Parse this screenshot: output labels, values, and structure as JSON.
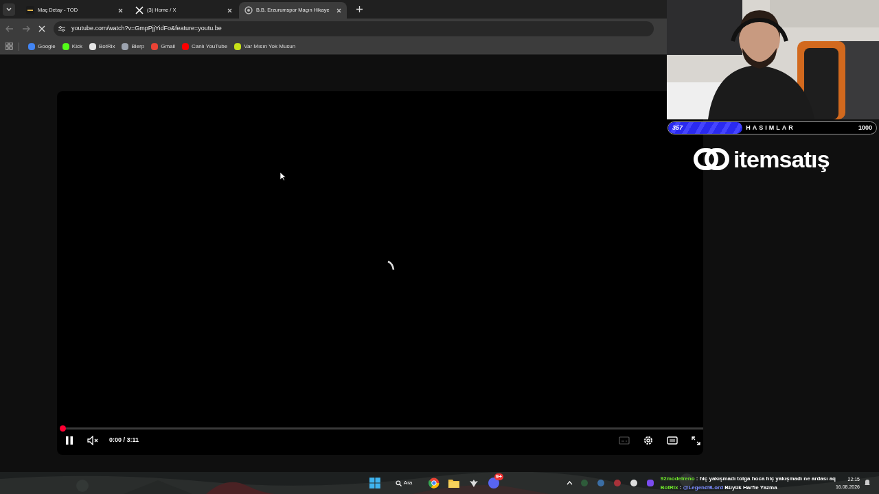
{
  "tabs": [
    {
      "title": "Maç Detay - TOD",
      "selected": false
    },
    {
      "title": "(3) Home / X",
      "selected": false
    },
    {
      "title": "B.B. Erzurumspor Maçın Hikaye",
      "selected": true
    }
  ],
  "address_bar": {
    "url": "youtube.com/watch?v=GmpPjjYidFo&feature=youtu.be",
    "loading": true
  },
  "bookmarks": [
    {
      "label": "Google",
      "color": "#4285f4"
    },
    {
      "label": "Kick",
      "color": "#53fc18"
    },
    {
      "label": "BotRix",
      "color": "#e5e5e5"
    },
    {
      "label": "Blerp",
      "color": "#9ca3af"
    },
    {
      "label": "Gmail",
      "color": "#ea4335"
    },
    {
      "label": "Canlı YouTube",
      "color": "#ff0000"
    },
    {
      "label": "Var Mısın Yok Musun",
      "color": "#c6e018"
    }
  ],
  "player": {
    "level": 0,
    "time": "0:00 / 3:11",
    "playing": true,
    "muted": true,
    "buffering": true
  },
  "overlay": {
    "goal_current": "357",
    "goal_label": "HASIMLAR",
    "goal_target": "1000",
    "level": 0.357,
    "sponsor": "itemsatış"
  },
  "taskbar": {
    "search": "Ara",
    "discord_badge": "9+"
  },
  "chat": [
    {
      "user": "92modelreno",
      "color": "#6ee52b",
      "separator": ":",
      "message": "hiç yakışmadı tolga hoca hiç yakışmadı ne ardası aq"
    },
    {
      "user": "BotRix",
      "color": "#6ee52b",
      "separator": ":",
      "mention": "@Legend9Lord",
      "message": "Büyük Harfle Yazma"
    }
  ],
  "clock": {
    "time": "22:15",
    "date": "16.08.2026"
  }
}
